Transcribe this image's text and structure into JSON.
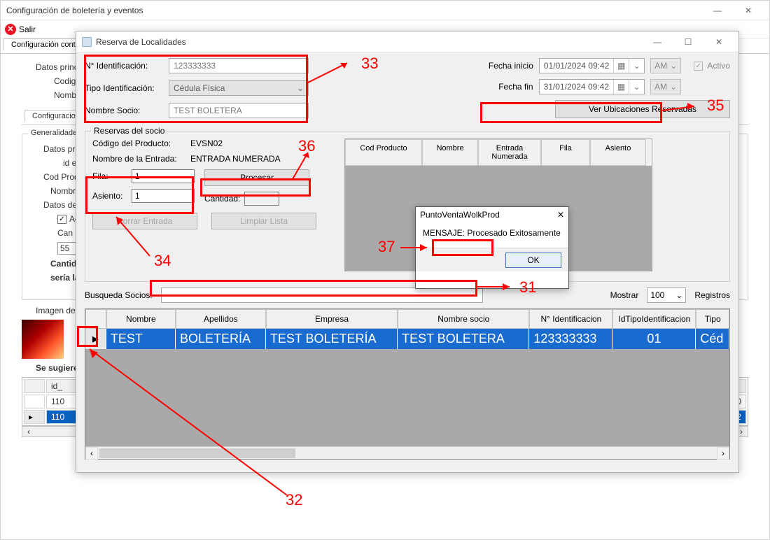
{
  "main_window": {
    "title": "Configuración de boletería y eventos",
    "salir": "Salir",
    "tab_main": "Configuración cont",
    "datos_principales": "Datos principales",
    "codigo_label": "Codig",
    "nombre_label": "Nombr",
    "tab_config": "Configuraciones",
    "group_generalidades": "Generalidade",
    "dp_label": "Datos princ",
    "id_label": "id e",
    "cod_prod_label": "Cod Prod / E",
    "nombre_e_label": "Nombre E",
    "datos_de": "Datos de e",
    "check_act": "Act",
    "can_label": "Can",
    "can_val": "55",
    "cantida": "Cantida",
    "seria_la": "sería la",
    "imagen_de": "Imagen de",
    "se_sugiere": "Se sugiere e",
    "bg_table": {
      "col_id": "id_",
      "rows": [
        "110",
        "110"
      ]
    }
  },
  "modal": {
    "title": "Reserva de Localidades",
    "id": {
      "n_identificacion": "N° Identificación:",
      "value": "123333333"
    },
    "tipo": {
      "label": "Tipo Identificación:",
      "value": "Cédula Física"
    },
    "socio": {
      "label": "Nombre Socio:",
      "value": "TEST BOLETERA"
    },
    "fecha_inicio": {
      "label": "Fecha inicio",
      "value": "01/01/2024 09:42",
      "ampm": "AM"
    },
    "fecha_fin": {
      "label": "Fecha fin",
      "value": "31/01/2024 09:42",
      "ampm": "AM"
    },
    "activo": "Activo",
    "ver_ubicaciones": "Ver Ubicaciones Reservadas",
    "reservas": {
      "legend": "Reservas del socio",
      "codigo_producto": {
        "label": "Código del Producto:",
        "value": "EVSN02"
      },
      "nombre_entrada": {
        "label": "Nombre de la Entrada:",
        "value": "ENTRADA NUMERADA"
      },
      "fila": {
        "label": "Fila:",
        "value": "1"
      },
      "asiento": {
        "label": "Asiento:",
        "value": "1"
      },
      "procesar": "Procesar",
      "cantidad": "Cantidad:",
      "borrar": "Borrar Entrada",
      "limpiar": "Limpiar Lista",
      "ub_headers": [
        "Cod Producto",
        "Nombre",
        "Entrada Numerada",
        "Fila",
        "Asiento"
      ]
    },
    "msg": {
      "title": "PuntoVentaWolkProd",
      "text": "MENSAJE: Procesado Exitosamente",
      "ok": "OK"
    },
    "busqueda": {
      "label": "Busqueda Socios:",
      "mostrar": "Mostrar",
      "count": "100",
      "registros": "Registros"
    },
    "grid": {
      "headers": [
        "Nombre",
        "Apellidos",
        "Empresa",
        "Nombre socio",
        "N° Identificacion",
        "IdTipoIdentificacion",
        "Tipo"
      ],
      "row": {
        "nombre": "TEST",
        "apellidos": "BOLETERÍA",
        "empresa": "TEST BOLETERÍA",
        "nombre_socio": "TEST BOLETERA",
        "ident": "123333333",
        "idtipo": "01",
        "tipo": "Céd"
      }
    }
  },
  "annotations": {
    "a31": "31",
    "a32": "32",
    "a33": "33",
    "a34": "34",
    "a35": "35",
    "a36": "36",
    "a37": "37"
  }
}
